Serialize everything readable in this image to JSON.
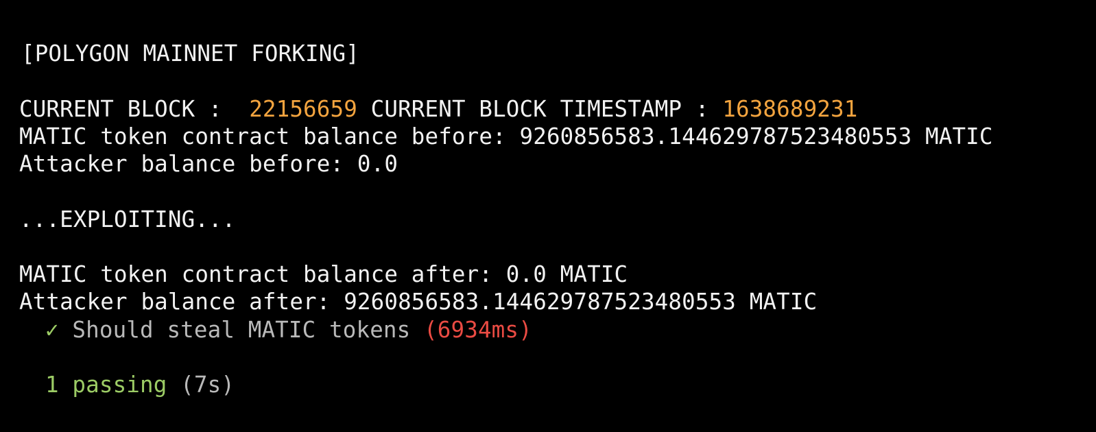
{
  "terminal": {
    "header": "[POLYGON MAINNET FORKING]",
    "block": {
      "label": "CURRENT BLOCK :  ",
      "number": "22156659",
      "timestamp_label": " CURRENT BLOCK TIMESTAMP : ",
      "timestamp": "1638689231"
    },
    "contract_before": "MATIC token contract balance before: 9260856583.144629787523480553 MATIC",
    "attacker_before": "Attacker balance before: 0.0",
    "exploiting": "...EXPLOITING...",
    "contract_after": "MATIC token contract balance after: 0.0 MATIC",
    "attacker_after": "Attacker balance after: 9260856583.144629787523480553 MATIC",
    "test": {
      "check": "✓",
      "name": " Should steal MATIC tokens ",
      "duration": "(6934ms)"
    },
    "summary": {
      "passing": "1 passing",
      "time": " (7s)"
    }
  },
  "colors": {
    "background": "#000000",
    "text": "#f2f2f2",
    "highlight": "#f3a43f",
    "pass": "#9ccc65",
    "muted": "#b9b9b9",
    "slow": "#ea4b43"
  }
}
